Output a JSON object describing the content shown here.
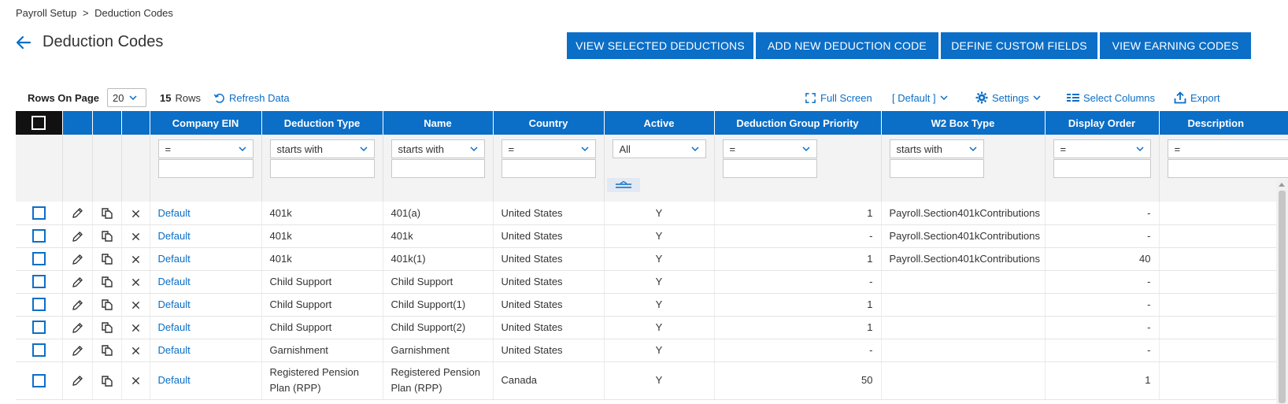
{
  "breadcrumb": {
    "parent": "Payroll Setup",
    "separator": ">",
    "current": "Deduction Codes"
  },
  "page": {
    "title": "Deduction Codes"
  },
  "actions": {
    "view_selected": "VIEW SELECTED DEDUCTIONS",
    "add_new": "ADD NEW DEDUCTION CODE",
    "define_custom": "DEFINE CUSTOM FIELDS",
    "view_earning": "VIEW EARNING CODES"
  },
  "toolbar": {
    "rows_on_page_label": "Rows On Page",
    "rows_on_page_value": "20",
    "row_count": "15",
    "rows_label": "Rows",
    "refresh": "Refresh Data",
    "full_screen": "Full Screen",
    "view_default": "[ Default ]",
    "settings": "Settings",
    "select_columns": "Select Columns",
    "export": "Export"
  },
  "columns": [
    "Company EIN",
    "Deduction Type",
    "Name",
    "Country",
    "Active",
    "Deduction Group Priority",
    "W2 Box Type",
    "Display Order",
    "Description"
  ],
  "filters": {
    "company_ein": "=",
    "deduction_type": "starts with",
    "name": "starts with",
    "country": "=",
    "active": "All",
    "priority": "=",
    "w2": "starts with",
    "display_order": "=",
    "description": "="
  },
  "rows": [
    {
      "ein": "Default",
      "type": "401k",
      "name": "401(a)",
      "country": "United States",
      "active": "Y",
      "priority": "1",
      "w2": "Payroll.Section401kContributions",
      "order": "-"
    },
    {
      "ein": "Default",
      "type": "401k",
      "name": "401k",
      "country": "United States",
      "active": "Y",
      "priority": "-",
      "w2": "Payroll.Section401kContributions",
      "order": "-"
    },
    {
      "ein": "Default",
      "type": "401k",
      "name": "401k(1)",
      "country": "United States",
      "active": "Y",
      "priority": "1",
      "w2": "Payroll.Section401kContributions",
      "order": "40"
    },
    {
      "ein": "Default",
      "type": "Child Support",
      "name": "Child Support",
      "country": "United States",
      "active": "Y",
      "priority": "-",
      "w2": "",
      "order": "-"
    },
    {
      "ein": "Default",
      "type": "Child Support",
      "name": "Child Support(1)",
      "country": "United States",
      "active": "Y",
      "priority": "1",
      "w2": "",
      "order": "-"
    },
    {
      "ein": "Default",
      "type": "Child Support",
      "name": "Child Support(2)",
      "country": "United States",
      "active": "Y",
      "priority": "1",
      "w2": "",
      "order": "-"
    },
    {
      "ein": "Default",
      "type": "Garnishment",
      "name": "Garnishment",
      "country": "United States",
      "active": "Y",
      "priority": "-",
      "w2": "",
      "order": "-"
    },
    {
      "ein": "Default",
      "type": "Registered Pension Plan (RPP)",
      "name": "Registered Pension Plan (RPP)",
      "country": "Canada",
      "active": "Y",
      "priority": "50",
      "w2": "",
      "order": "1"
    }
  ],
  "colors": {
    "primary": "#0b6ec7",
    "header_check_bg": "#111111",
    "filter_bg": "#f3f3f3"
  }
}
